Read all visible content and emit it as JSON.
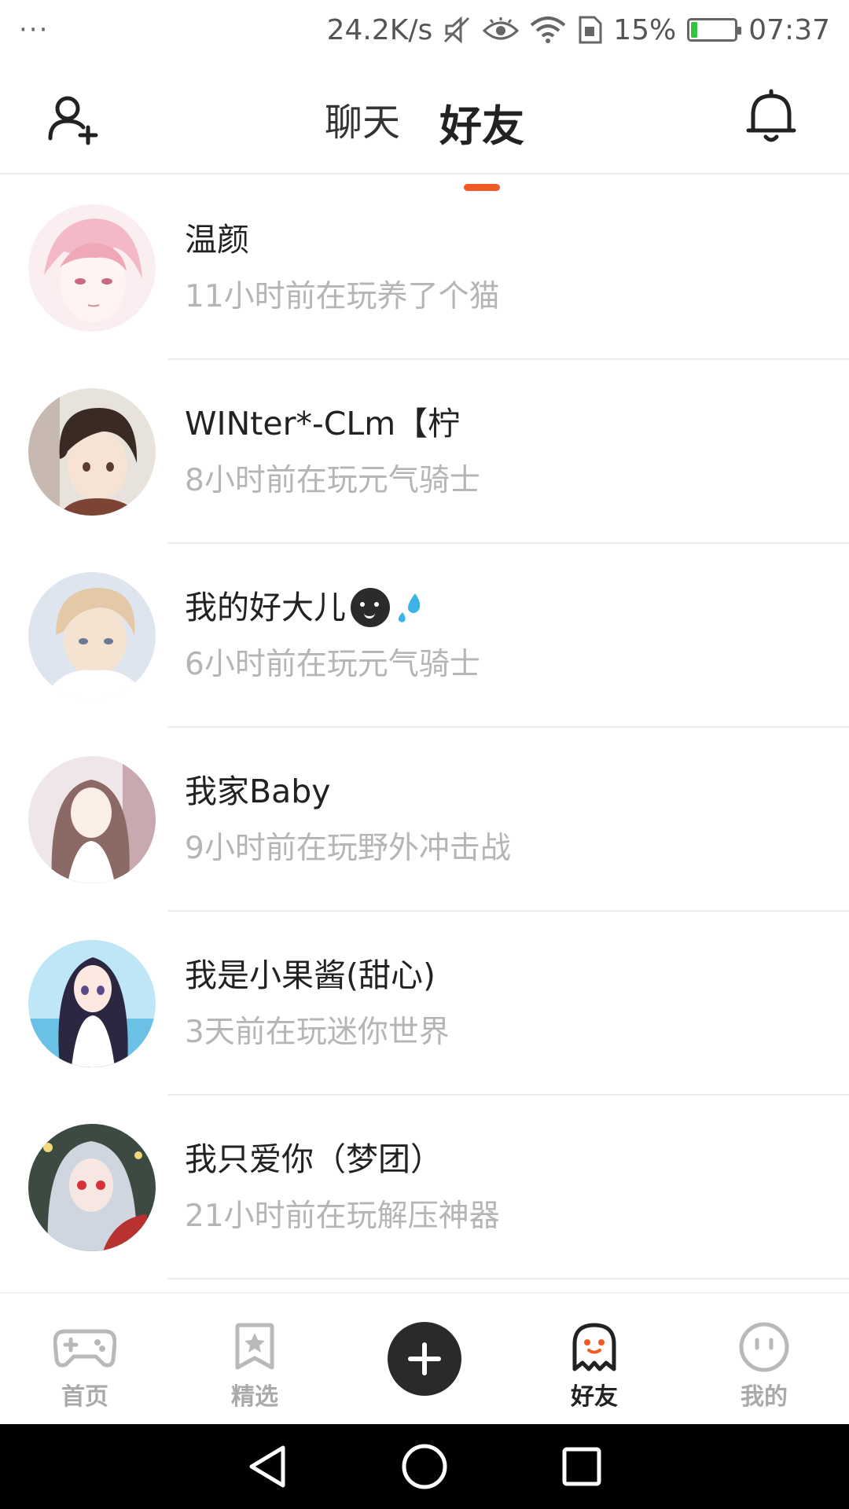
{
  "status_bar": {
    "menu_dots": "···",
    "net_speed": "24.2K/s",
    "battery_percent": "15%",
    "battery_level": 0.15,
    "time": "07:37",
    "icons": [
      "mute-icon",
      "eye-icon",
      "wifi-icon",
      "sim-icon",
      "battery-icon"
    ]
  },
  "header": {
    "tabs": [
      {
        "label": "聊天",
        "active": false
      },
      {
        "label": "好友",
        "active": true
      }
    ],
    "left_icon": "add-friend-icon",
    "right_icon": "bell-icon"
  },
  "friends": [
    {
      "name": "温颜",
      "status": "11小时前在玩养了个猫"
    },
    {
      "name": "WINter*-CLm【柠",
      "status": "8小时前在玩元气骑士"
    },
    {
      "name": "我的好大儿",
      "emojis": [
        "dark-face-emoji",
        "sweat-drop-emoji"
      ],
      "status": "6小时前在玩元气骑士"
    },
    {
      "name": "我家Baby",
      "status": "9小时前在玩野外冲击战"
    },
    {
      "name": "我是小果酱(甜心)",
      "status": "3天前在玩迷你世界"
    },
    {
      "name": "我只爱你（梦团）",
      "status": "21小时前在玩解压神器"
    }
  ],
  "bottom_nav": {
    "items": [
      {
        "label": "首页",
        "icon": "gamepad-icon",
        "active": false
      },
      {
        "label": "精选",
        "icon": "star-bookmark-icon",
        "active": false
      },
      {
        "label": "",
        "icon": "plus-icon",
        "active": false
      },
      {
        "label": "好友",
        "icon": "ghost-icon",
        "active": true
      },
      {
        "label": "我的",
        "icon": "face-icon",
        "active": false
      }
    ]
  },
  "colors": {
    "accent": "#f15a22",
    "text_primary": "#222222",
    "text_secondary": "#b5b5b5",
    "divider": "#ececec"
  }
}
